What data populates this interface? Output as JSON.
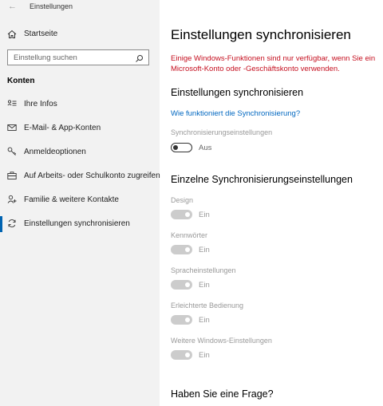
{
  "app": {
    "title": "Einstellungen"
  },
  "sidebar": {
    "home_label": "Startseite",
    "search_placeholder": "Einstellung suchen",
    "section_title": "Konten",
    "items": [
      {
        "label": "Ihre Infos",
        "icon": "person-card-icon"
      },
      {
        "label": "E-Mail- & App-Konten",
        "icon": "mail-icon"
      },
      {
        "label": "Anmeldeoptionen",
        "icon": "key-icon"
      },
      {
        "label": "Auf Arbeits- oder Schulkonto zugreifen",
        "icon": "briefcase-icon"
      },
      {
        "label": "Familie & weitere Kontakte",
        "icon": "person-add-icon"
      },
      {
        "label": "Einstellungen synchronisieren",
        "icon": "sync-icon",
        "active": true
      }
    ]
  },
  "main": {
    "title": "Einstellungen synchronisieren",
    "warning": "Einige Windows-Funktionen sind nur verfügbar, wenn Sie ein Microsoft-Konto oder -Geschäftskonto verwenden.",
    "sync_heading": "Einstellungen synchronisieren",
    "help_link": "Wie funktioniert die Synchronisierung?",
    "sync_settings": {
      "label": "Synchronisierungseinstellungen",
      "state": "Aus"
    },
    "individual_heading": "Einzelne Synchronisierungseinstellungen",
    "individual": [
      {
        "label": "Design",
        "state": "Ein"
      },
      {
        "label": "Kennwörter",
        "state": "Ein"
      },
      {
        "label": "Spracheinstellungen",
        "state": "Ein"
      },
      {
        "label": "Erleichterte Bedienung",
        "state": "Ein"
      },
      {
        "label": "Weitere Windows-Einstellungen",
        "state": "Ein"
      }
    ],
    "faq_heading": "Haben Sie eine Frage?"
  },
  "colors": {
    "accent": "#0063b1",
    "link": "#0067c0",
    "warning": "#c50f1f",
    "sidebar_bg": "#f2f2f2",
    "toggle_disabled": "#cccccc"
  }
}
